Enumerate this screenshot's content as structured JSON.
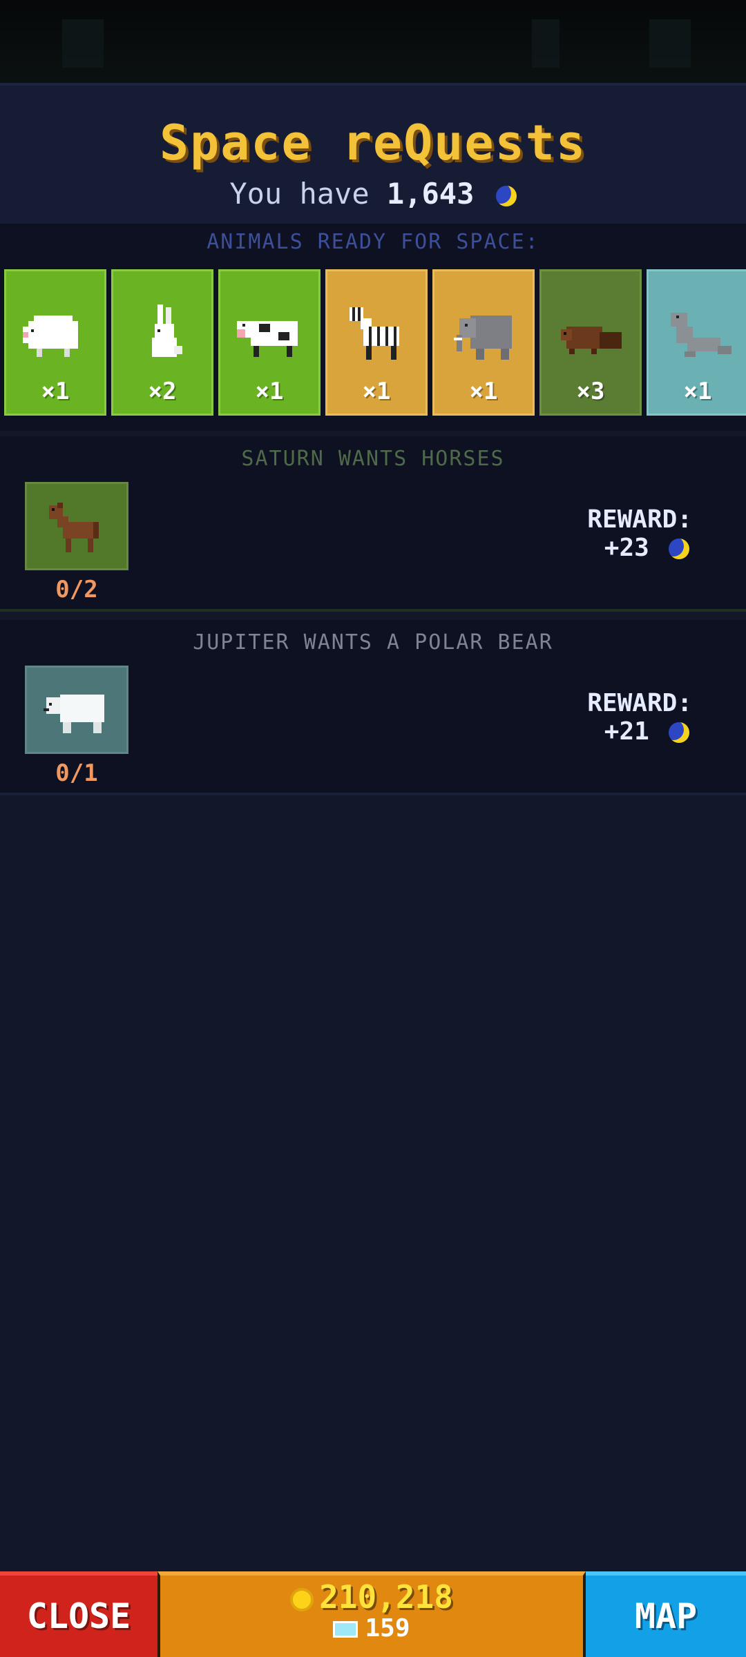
{
  "header": {
    "title": "Space reQuests",
    "balance_prefix": "You have",
    "balance_amount": "1,643",
    "currency_icon": "moon-icon"
  },
  "animals": {
    "label": "ANIMALS READY FOR SPACE:",
    "items": [
      {
        "animal": "sheep",
        "count": "×1",
        "color": "#6ab424"
      },
      {
        "animal": "rabbit",
        "count": "×2",
        "color": "#6ab424"
      },
      {
        "animal": "cow",
        "count": "×1",
        "color": "#6ab424"
      },
      {
        "animal": "zebra",
        "count": "×1",
        "color": "#d9a43c"
      },
      {
        "animal": "elephant",
        "count": "×1",
        "color": "#d9a43c"
      },
      {
        "animal": "beaver",
        "count": "×3",
        "color": "#5b7d33"
      },
      {
        "animal": "seal",
        "count": "×1",
        "color": "#6bb1b4"
      }
    ]
  },
  "requests": [
    {
      "title": "SATURN WANTS HORSES",
      "animal": "horse",
      "progress": "0/2",
      "reward_label": "REWARD:",
      "reward_value": "+23"
    },
    {
      "title": "JUPITER WANTS A POLAR BEAR",
      "animal": "polar-bear",
      "progress": "0/1",
      "reward_label": "REWARD:",
      "reward_value": "+21"
    }
  ],
  "bottom_bar": {
    "close_label": "CLOSE",
    "coins": "210,218",
    "gems": "159",
    "map_label": "MAP"
  }
}
